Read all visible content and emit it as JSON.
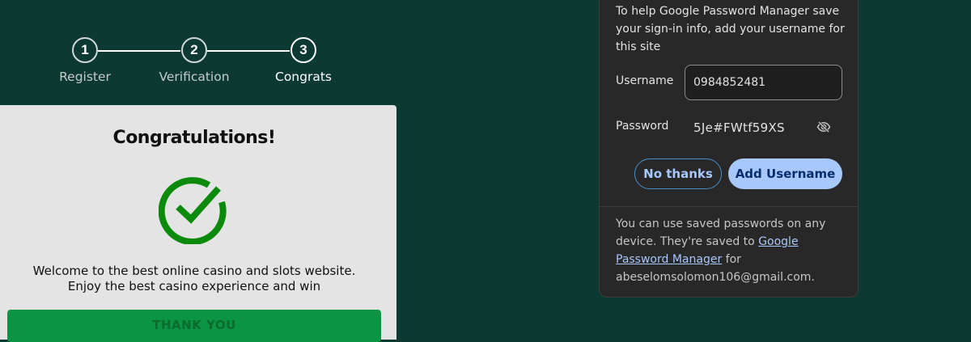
{
  "stepper": {
    "steps": [
      {
        "number": "1",
        "label": "Register"
      },
      {
        "number": "2",
        "label": "Verification"
      },
      {
        "number": "3",
        "label": "Congrats"
      }
    ],
    "active_step": 3
  },
  "card": {
    "title": "Congratulations!",
    "icon": "check-circle-icon",
    "message": "Welcome to the best online casino and slots website. Enjoy the best casino experience and win",
    "button_label": "THANK YOU",
    "accent_color": "#0b8a0b",
    "button_color": "#0b9444"
  },
  "password_manager": {
    "intro": "To help Google Password Manager save your sign-in info, add your username for this site",
    "username_label": "Username",
    "username_value": "0984852481",
    "password_label": "Password",
    "password_value": "5Je#FWtf59XS",
    "password_visibility_icon": "eye-off-icon",
    "no_thanks_label": "No thanks",
    "add_username_label": "Add Username",
    "footer_prefix": "You can use saved passwords on any device. They're saved to ",
    "footer_link": "Google Password Manager",
    "footer_middle": " for ",
    "footer_email": "abeselomsolomon106@gmail.com",
    "footer_suffix": "."
  },
  "colors": {
    "page_background": "#0c3a33",
    "popup_background": "#282828",
    "primary_button": "#a8c7fa"
  }
}
